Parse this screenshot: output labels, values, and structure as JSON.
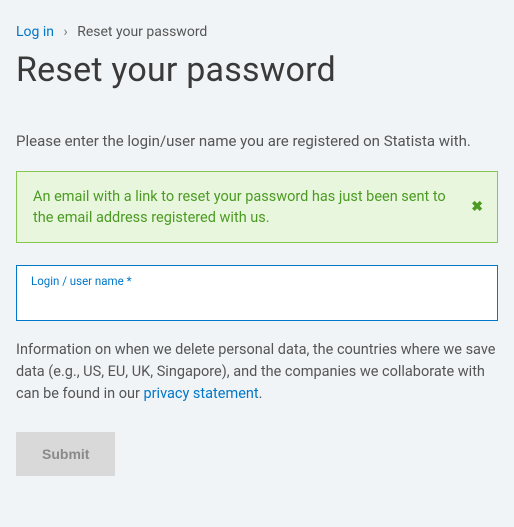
{
  "breadcrumb": {
    "login_label": "Log in",
    "separator": "›",
    "current": "Reset your password"
  },
  "page_title": "Reset your password",
  "intro_text": "Please enter the login/user name you are registered on Statista with.",
  "alert": {
    "message": "An email with a link to reset your password has just been sent to the email address registered with us.",
    "close_glyph": "✖"
  },
  "login_field": {
    "label": "Login / user name *",
    "value": ""
  },
  "info": {
    "prefix": "Information on when we delete personal data, the countries where we save data (e.g., US, EU, UK, Singapore), and the companies we collaborate with can be found in our ",
    "link_text": "privacy statement",
    "suffix": "."
  },
  "submit_label": "Submit"
}
